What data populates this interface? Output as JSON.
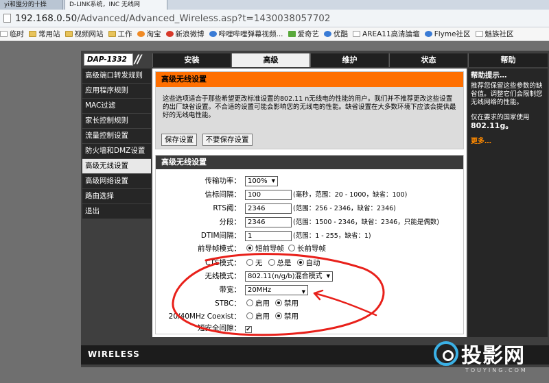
{
  "browser": {
    "tabs": [
      "yi和盟分的十操",
      "D-LINK系统，INC 无线网"
    ],
    "url_host": "192.168.0.50",
    "url_path": "/Advanced/Advanced_Wireless.asp?t=1430038057702",
    "bookmarks": [
      {
        "label": "临时",
        "icon": "page"
      },
      {
        "label": "常用站",
        "icon": "folder"
      },
      {
        "label": "视频网站",
        "icon": "folder"
      },
      {
        "label": "工作",
        "icon": "folder"
      },
      {
        "label": "淘宝",
        "icon": "orange"
      },
      {
        "label": "新浪微博",
        "icon": "red"
      },
      {
        "label": "哔哩哔哩弹幕视频...",
        "icon": "blue"
      },
      {
        "label": "爱奇艺",
        "icon": "green"
      },
      {
        "label": "优酷",
        "icon": "blue"
      },
      {
        "label": "AREA11高清論壇",
        "icon": "page"
      },
      {
        "label": "Flyme社区",
        "icon": "blue"
      },
      {
        "label": "魅族社区",
        "icon": "page"
      }
    ]
  },
  "router": {
    "model": "DAP-1332",
    "nav": [
      "安装",
      "高级",
      "维护",
      "状态",
      "帮助"
    ],
    "sidebar": [
      "高级端口转发规则",
      "应用程序规则",
      "MAC过滤",
      "家长控制规则",
      "流量控制设置",
      "防火墙和DMZ设置",
      "高级无线设置",
      "高级网络设置",
      "路由选择",
      "退出"
    ],
    "intro": {
      "title": "高级无线设置",
      "description": "这些选项适合于那些希望更改标准设置的802.11 n无线电的性能的用户。我们并不推荐更改这些设置的出厂缺省设置。不合适的设置可能会影响您的无线电的性能。缺省设置在大多数环境下应该会提供最好的无线电性能。",
      "save_label": "保存设置",
      "nosave_label": "不要保存设置"
    },
    "settings": {
      "title": "高级无线设置",
      "tx_power": {
        "label": "传输功率：",
        "value": "100%"
      },
      "beacon": {
        "label": "信标间隔：",
        "value": "100",
        "hint": "(毫秒，范围：20 - 1000，缺省：100)"
      },
      "rts": {
        "label": "RTS阈：",
        "value": "2346",
        "hint": "(范围：256 - 2346，缺省：2346)"
      },
      "frag": {
        "label": "分段：",
        "value": "2346",
        "hint": "(范围：1500 - 2346，缺省：2346，只能是偶数)"
      },
      "dtim": {
        "label": "DTIM间隔：",
        "value": "1",
        "hint": "(范围：1 - 255，缺省：1)"
      },
      "preamble": {
        "label": "前导帧模式：",
        "opt1": "短前导帧",
        "opt2": "长前导帧"
      },
      "cts": {
        "label": "CTS模式：",
        "opt1": "无",
        "opt2": "总是",
        "opt3": "自动"
      },
      "mode": {
        "label": "无线模式：",
        "value": "802.11(n/g/b)混合模式"
      },
      "bandwidth": {
        "label": "带宽：",
        "value": "20MHz"
      },
      "stbc": {
        "label": "STBC：",
        "opt1": "启用",
        "opt2": "禁用"
      },
      "coexist": {
        "label": "20/40MHz Coexist：",
        "opt1": "启用",
        "opt2": "禁用"
      },
      "short_gi": {
        "label": "短安全间隙："
      }
    },
    "help": {
      "title": "帮助提示…",
      "p1": "推荐您保留这些参数的缺省值。调整它们会限制您无线网络的性能。",
      "p2a": "仅在要求的国家使用",
      "p2b": "802.11g。",
      "more": "更多…"
    },
    "footer_brand": "WIRELESS"
  },
  "watermark": {
    "text": "投影网",
    "sub": "TOUYING.COM"
  },
  "colors": {
    "accent": "#ff6f00",
    "annotation": "#e8201a",
    "watermark": "#3bb1e6"
  }
}
